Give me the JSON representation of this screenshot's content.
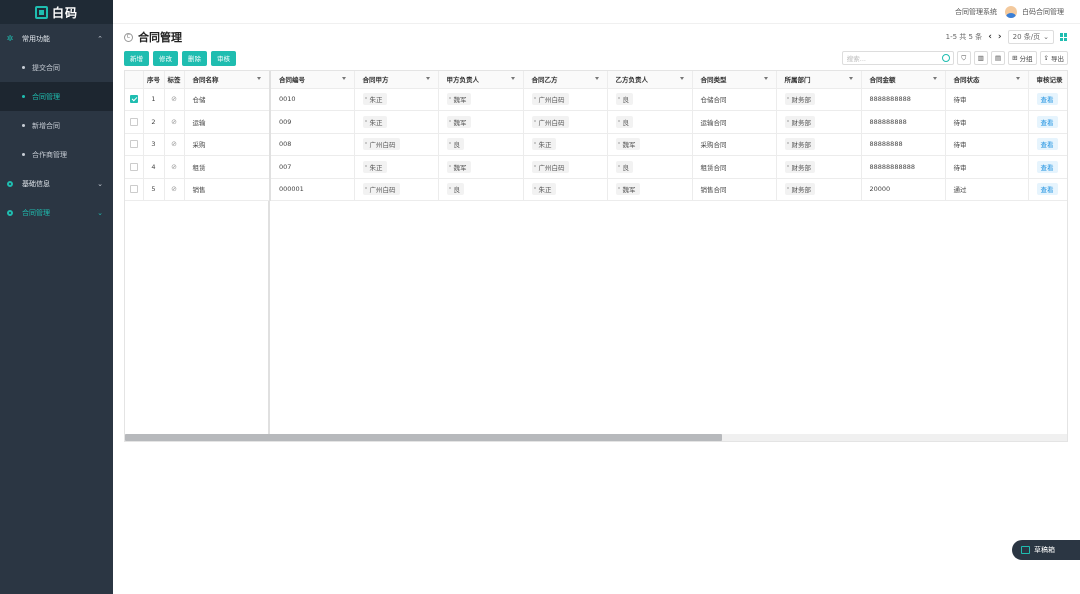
{
  "app": {
    "logo_text": "白码",
    "accent": "#1fbdb0",
    "sidebar_bg": "#2b3643"
  },
  "sidebar": {
    "groups": [
      {
        "label": "常用功能",
        "icon": "gear-icon",
        "expanded": true,
        "items": [
          {
            "label": "提交合同",
            "active": false
          },
          {
            "label": "合同管理",
            "active": true
          },
          {
            "label": "新增合同",
            "active": false
          },
          {
            "label": "合作商管理",
            "active": false
          }
        ]
      },
      {
        "label": "基础信息",
        "icon": "circle-icon",
        "expanded": false
      },
      {
        "label": "合同管理",
        "icon": "circle-icon",
        "expanded": false
      }
    ]
  },
  "header": {
    "system_name": "合同管理系统",
    "user_name": "白码合同管理"
  },
  "page": {
    "title": "合同管理",
    "pager": {
      "range": "1-5 共 5 条",
      "page_size": "20 条/页"
    }
  },
  "toolbar": {
    "buttons": [
      "新增",
      "修改",
      "删除",
      "审核"
    ],
    "search_placeholder": "搜索...",
    "group_label": "分组",
    "export_label": "导出"
  },
  "table": {
    "fixed_headers": {
      "index": "序号",
      "tag": "标签",
      "name": "合同名称"
    },
    "headers": [
      "合同编号",
      "合同甲方",
      "甲方负责人",
      "合同乙方",
      "乙方负责人",
      "合同类型",
      "所属部门",
      "合同金额",
      "合同状态",
      "审核记录"
    ],
    "view_label": "查看",
    "rows": [
      {
        "index": "1",
        "checked": true,
        "name": "仓储",
        "cells": [
          "0010",
          "朱正",
          "魏军",
          "广州白码",
          "良",
          "仓储合同",
          "财务部",
          "8888888888",
          "待审"
        ]
      },
      {
        "index": "2",
        "checked": false,
        "name": "运输",
        "cells": [
          "009",
          "朱正",
          "魏军",
          "广州白码",
          "良",
          "运输合同",
          "财务部",
          "888888888",
          "待审"
        ]
      },
      {
        "index": "3",
        "checked": false,
        "name": "采购",
        "cells": [
          "008",
          "广州白码",
          "良",
          "朱正",
          "魏军",
          "采购合同",
          "财务部",
          "88888888",
          "待审"
        ]
      },
      {
        "index": "4",
        "checked": false,
        "name": "租赁",
        "cells": [
          "007",
          "朱正",
          "魏军",
          "广州白码",
          "良",
          "租赁合同",
          "财务部",
          "88888888888",
          "待审"
        ]
      },
      {
        "index": "5",
        "checked": false,
        "name": "销售",
        "cells": [
          "000001",
          "广州白码",
          "良",
          "朱正",
          "魏军",
          "销售合同",
          "财务部",
          "20000",
          "通过"
        ]
      }
    ]
  },
  "float_button": {
    "label": "草稿箱"
  }
}
